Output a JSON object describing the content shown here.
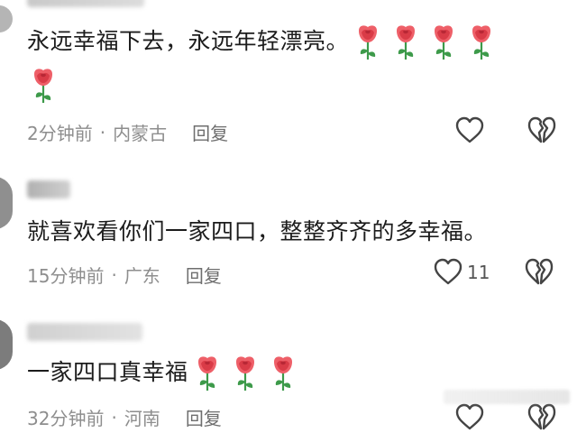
{
  "comments": [
    {
      "text": "永远幸福下去，永远年轻漂亮。",
      "time": "2分钟前",
      "location": "内蒙古",
      "reply": "回复"
    },
    {
      "text": "就喜欢看你们一家四口，整整齐齐的多幸福。",
      "time": "15分钟前",
      "location": "广东",
      "reply": "回复",
      "likes": "11"
    },
    {
      "text": "一家四口真幸福",
      "time": "32分钟前",
      "location": "河南",
      "reply": "回复"
    }
  ],
  "icons": {
    "rose": "rose-emoji",
    "like": "heart-outline-icon",
    "dislike": "broken-heart-icon"
  },
  "colors": {
    "rose_petal": "#e8525c",
    "rose_leaf": "#3d9a4a",
    "muted_text": "#8e8e8e",
    "icon_stroke": "#444444"
  }
}
